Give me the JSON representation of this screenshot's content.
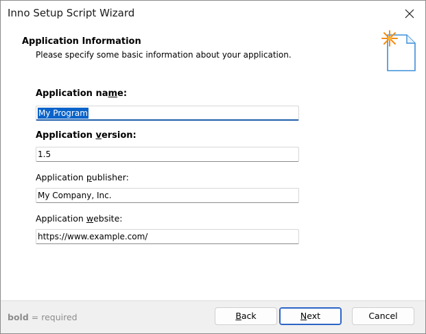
{
  "window": {
    "title": "Inno Setup Script Wizard"
  },
  "header": {
    "title": "Application Information",
    "subtitle": "Please specify some basic information about your application."
  },
  "fields": {
    "app_name": {
      "label_pre": "Application na",
      "label_key": "m",
      "label_post": "e:",
      "value": "My Program"
    },
    "app_version": {
      "label_pre": "Application ",
      "label_key": "v",
      "label_post": "ersion:",
      "value": "1.5"
    },
    "app_publisher": {
      "label_pre": "Application ",
      "label_key": "p",
      "label_post": "ublisher:",
      "value": "My Company, Inc."
    },
    "app_website": {
      "label_pre": "Application ",
      "label_key": "w",
      "label_post": "ebsite:",
      "value": "https://www.example.com/"
    }
  },
  "footer": {
    "hint_bold": "bold",
    "hint_rest": " = required",
    "back_key": "B",
    "back_rest": "ack",
    "next_key": "N",
    "next_rest": "ext",
    "cancel_label": "Cancel"
  },
  "icons": {
    "close": "close-icon",
    "wizard": "document-sparkle-icon"
  },
  "colors": {
    "selection": "#0a63c9",
    "focus_underline": "#1f5ea8",
    "default_button_border": "#2b64c6",
    "hint_text": "#8c8c8c",
    "sparkle": "#f28c13"
  }
}
